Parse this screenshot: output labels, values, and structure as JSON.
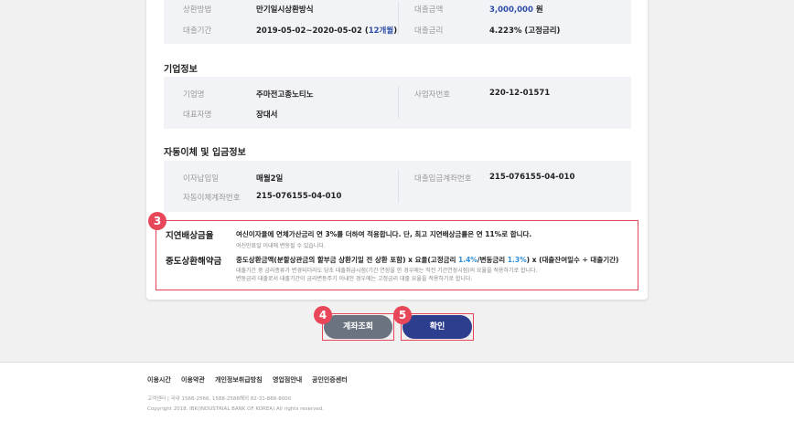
{
  "loan_info": {
    "repay_method_label": "상환방법",
    "repay_method_value": "만기일시상환방식",
    "amount_label": "대출금액",
    "amount_value": "3,000,000",
    "amount_unit": "원",
    "period_label": "대출기간",
    "period_value": "2019-05-02~2020-05-02 (",
    "period_months": "12개월",
    "period_close": ")",
    "rate_label": "대출금리",
    "rate_value": "4.223% (고정금리)"
  },
  "company": {
    "title": "기업정보",
    "name_label": "기업명",
    "name_value": "주마전고종노티노",
    "bizno_label": "사업자번호",
    "bizno_value": "220-12-01571",
    "ceo_label": "대표자명",
    "ceo_value": "장대서"
  },
  "autopay": {
    "title": "자동이체 및 입금정보",
    "payday_label": "이자납입일",
    "payday_value": "매월2일",
    "deposit_label": "대출입금계좌번호",
    "deposit_value": "215-076155-04-010",
    "auto_label": "자동이체계좌번호",
    "auto_value": "215-076155-04-010"
  },
  "notice": {
    "badge": "3",
    "late_title": "지연배상금율",
    "late_main": "여신이자율에 연체가산금리 연 3%를 더하여 적용합니다. 단, 최고 지연배상금률은 연 11%로 합니다.",
    "late_sub": "여신만료일 이내에 변동될 수 있습니다.",
    "early_title": "중도상환해약금",
    "early_main_1": "중도상환금액(분할상관금의 할부금 상환기일 전 상환 포함) x 요율(고정금리 ",
    "early_rate_fixed": "1.4%",
    "early_main_2": "/변동금리 ",
    "early_rate_var": "1.3%",
    "early_main_3": ") x (대출잔여일수 ÷ 대출기간)",
    "early_sub_1": "대출기간 중 금리종류가 변경되더라도 당초 대출취급시점(기간 연장을 한 경우에는 직전 기간연장시점)의 요율을 적용하기로 합니다.",
    "early_sub_2": "변동금리 대출로서 대출기간이 금리변동주기 이내인 경우에는 고정금리 대출 요율을 적용하기로 합니다."
  },
  "buttons": {
    "badge_account": "4",
    "account_label": "계좌조회",
    "badge_confirm": "5",
    "confirm_label": "확인"
  },
  "footer": {
    "nav": [
      "이용시간",
      "이용약관",
      "개인정보취급방침",
      "영업점안내",
      "공인인증센터"
    ],
    "contact": "고객센터  |  국내 1566-2566, 1588-2588해외 82-31-888-8000",
    "copyright": "Copyright 2018. IBK(INDUSTRIAL BANK OF KOREA) All rights reserved."
  },
  "colors": {
    "accent_red": "#e8475a",
    "brand_blue": "#2d3e8f",
    "highlight_blue": "#2f8fd8"
  }
}
